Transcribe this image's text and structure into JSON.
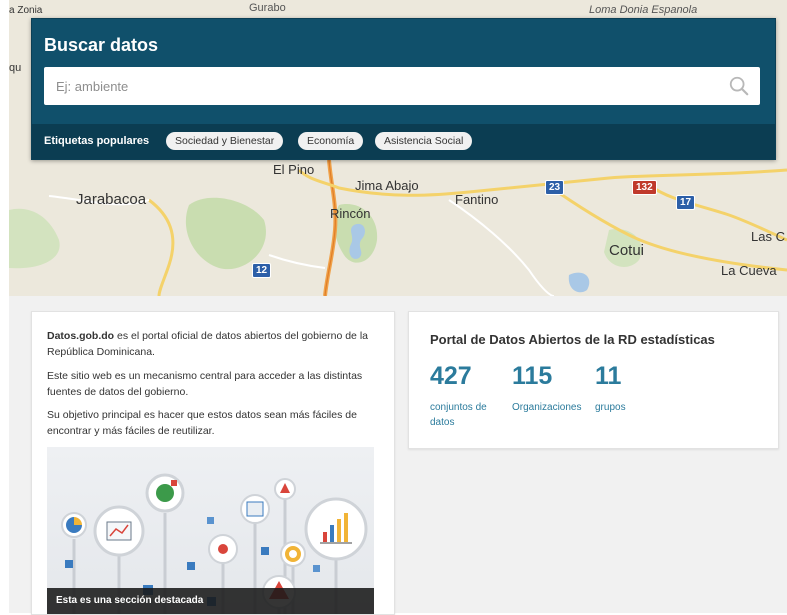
{
  "map": {
    "place_labels": {
      "zona": "a Zonia",
      "gurabo": "Gurabo",
      "loma": "Loma Donia Espanola",
      "qu": "qu",
      "el_pino": "El Pino",
      "jima": "Jima Abajo",
      "fantino": "Fantino",
      "jarabacoa": "Jarabacoa",
      "rincon": "Rincón",
      "cotui": "Cotui",
      "las_c": "Las C",
      "la_cueva": "La Cueva"
    },
    "shields": {
      "s23": "23",
      "s132": "132",
      "s17": "17",
      "s12": "12"
    }
  },
  "search": {
    "title": "Buscar datos",
    "placeholder": "Ej: ambiente",
    "popular_label": "Etiquetas populares",
    "tags": [
      "Sociedad y Bienestar",
      "Economía",
      "Asistencia Social"
    ]
  },
  "about": {
    "brand": "Datos.gob.do",
    "intro_rest": " es el portal oficial de datos abiertos del gobierno de la República Dominicana.",
    "p2": "Este sitio web es un mecanismo central para acceder a las distintas fuentes de datos del gobierno.",
    "p3": "Su objetivo principal es hacer que estos datos sean más fáciles de encontrar y más fáciles de reutilizar.",
    "featured_caption": "Esta es una sección destacada"
  },
  "stats": {
    "title": "Portal de Datos Abiertos de la RD estadísticas",
    "items": [
      {
        "value": "427",
        "label": "conjuntos de datos"
      },
      {
        "value": "115",
        "label": "Organizaciones"
      },
      {
        "value": "11",
        "label": "grupos"
      }
    ]
  },
  "colors": {
    "search_bg": "#10506b",
    "tags_bar_bg": "#0b3d52",
    "stat_accent": "#2b7b9c"
  }
}
